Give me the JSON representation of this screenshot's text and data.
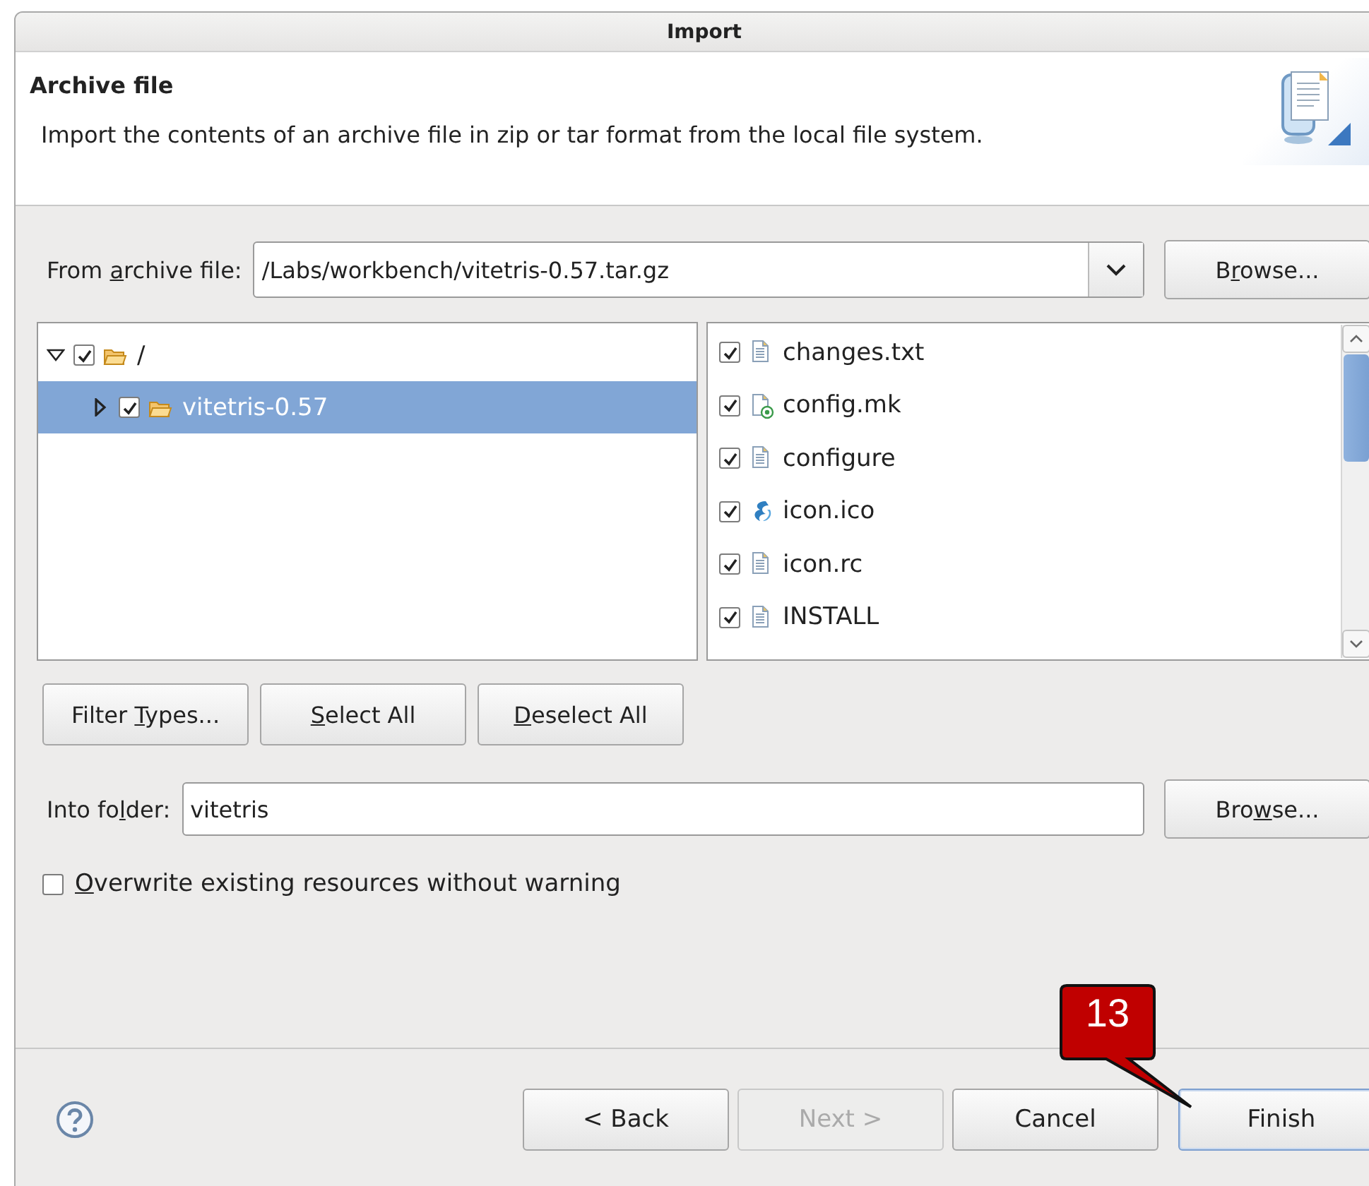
{
  "window": {
    "title": "Import"
  },
  "header": {
    "title": "Archive file",
    "description": "Import the contents of an archive file in zip or tar format from the local file system."
  },
  "source": {
    "label_parts": {
      "before": "From ",
      "key": "a",
      "after": "rchive file:"
    },
    "value": "/Labs/workbench/vitetris-0.57.tar.gz",
    "browse_parts": {
      "before": "B",
      "key": "r",
      "after": "owse..."
    }
  },
  "tree": [
    {
      "label": "/",
      "expanded": true,
      "checked": true,
      "selected": false,
      "children": [
        {
          "label": "vitetris-0.57",
          "expanded": false,
          "checked": true,
          "selected": true
        }
      ]
    }
  ],
  "files": [
    {
      "name": "changes.txt",
      "checked": true,
      "kind": "text"
    },
    {
      "name": "config.mk",
      "checked": true,
      "kind": "make"
    },
    {
      "name": "configure",
      "checked": true,
      "kind": "text"
    },
    {
      "name": "icon.ico",
      "checked": true,
      "kind": "image"
    },
    {
      "name": "icon.rc",
      "checked": true,
      "kind": "text"
    },
    {
      "name": "INSTALL",
      "checked": true,
      "kind": "text"
    }
  ],
  "selection_buttons": [
    {
      "parts": {
        "before": "Filter ",
        "key": "T",
        "after": "ypes..."
      }
    },
    {
      "parts": {
        "key": "S",
        "after": "elect All"
      }
    },
    {
      "parts": {
        "key": "D",
        "after": "eselect All"
      }
    }
  ],
  "target": {
    "label_parts": {
      "before": "Into fo",
      "key": "l",
      "after": "der:"
    },
    "value": "vitetris",
    "browse_parts": {
      "before": "Bro",
      "key": "w",
      "after": "se..."
    }
  },
  "overwrite": {
    "parts": {
      "key": "O",
      "after": "verwrite existing resources without warning"
    },
    "checked": false
  },
  "nav_buttons": [
    {
      "label": "< Back",
      "disabled": false,
      "default": false
    },
    {
      "label": "Next >",
      "disabled": true,
      "default": false
    },
    {
      "label": "Cancel",
      "disabled": false,
      "default": false
    },
    {
      "label": "Finish",
      "disabled": false,
      "default": true
    }
  ],
  "callout": {
    "label": "13"
  }
}
